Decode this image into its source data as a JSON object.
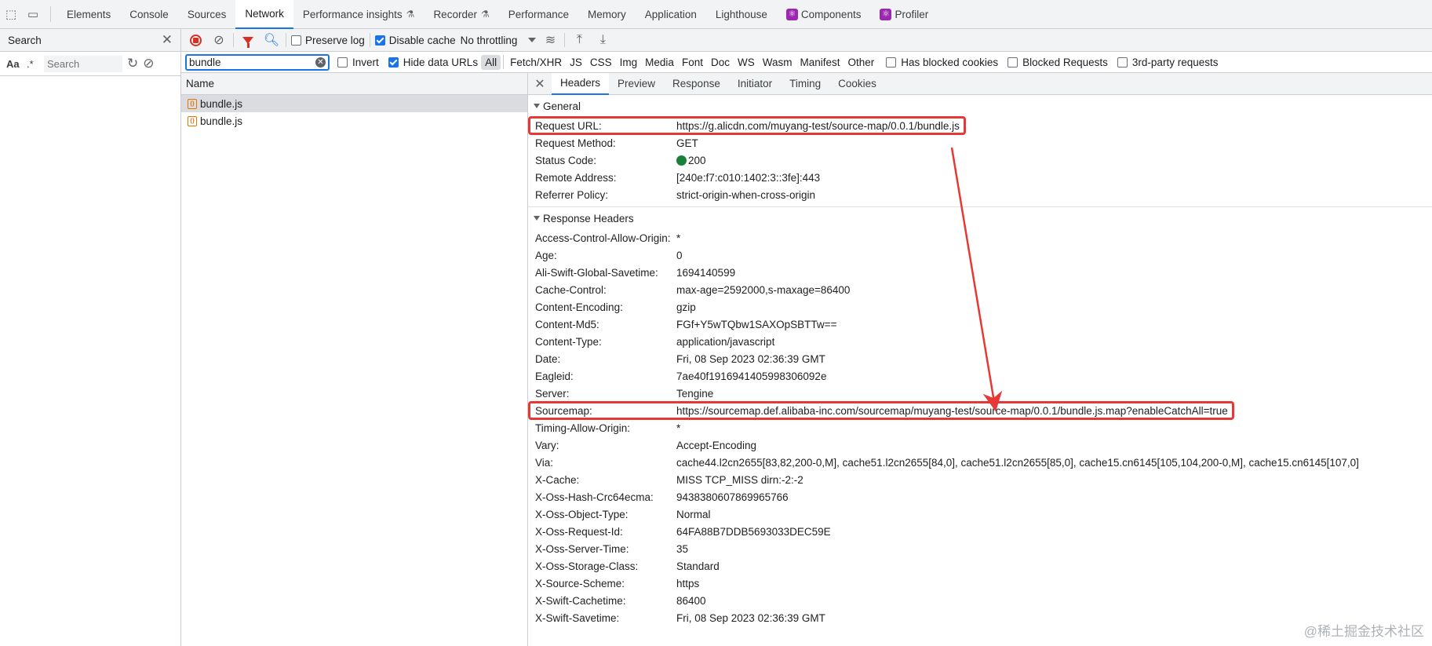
{
  "tabs": [
    {
      "label": "Elements",
      "active": false,
      "badge": ""
    },
    {
      "label": "Console",
      "active": false,
      "badge": ""
    },
    {
      "label": "Sources",
      "active": false,
      "badge": ""
    },
    {
      "label": "Network",
      "active": true,
      "badge": ""
    },
    {
      "label": "Performance insights",
      "active": false,
      "badge": "flask"
    },
    {
      "label": "Recorder",
      "active": false,
      "badge": "flask"
    },
    {
      "label": "Performance",
      "active": false,
      "badge": ""
    },
    {
      "label": "Memory",
      "active": false,
      "badge": ""
    },
    {
      "label": "Application",
      "active": false,
      "badge": ""
    },
    {
      "label": "Lighthouse",
      "active": false,
      "badge": ""
    },
    {
      "label": "Components",
      "active": false,
      "badge": "react"
    },
    {
      "label": "Profiler",
      "active": false,
      "badge": "react"
    }
  ],
  "search_panel": {
    "title": "Search",
    "aa_label": "Aa",
    "regex_label": ".*",
    "placeholder": "Search"
  },
  "toolbar": {
    "preserve_log": {
      "label": "Preserve log",
      "checked": false
    },
    "disable_cache": {
      "label": "Disable cache",
      "checked": true
    },
    "throttling": "No throttling"
  },
  "filter_bar": {
    "value": "bundle",
    "invert": {
      "label": "Invert",
      "checked": false
    },
    "hide_data_urls": {
      "label": "Hide data URLs",
      "checked": true
    },
    "types": [
      "All",
      "Fetch/XHR",
      "JS",
      "CSS",
      "Img",
      "Media",
      "Font",
      "Doc",
      "WS",
      "Wasm",
      "Manifest",
      "Other"
    ],
    "active_type": "All",
    "has_blocked_cookies": {
      "label": "Has blocked cookies",
      "checked": false
    },
    "blocked_requests": {
      "label": "Blocked Requests",
      "checked": false
    },
    "third_party": {
      "label": "3rd-party requests",
      "checked": false
    }
  },
  "request_list": {
    "header": "Name",
    "rows": [
      {
        "name": "bundle.js",
        "selected": true
      },
      {
        "name": "bundle.js",
        "selected": false
      }
    ]
  },
  "detail_tabs": [
    "Headers",
    "Preview",
    "Response",
    "Initiator",
    "Timing",
    "Cookies"
  ],
  "general": {
    "title": "General",
    "rows": [
      {
        "key": "Request URL:",
        "value": "https://g.alicdn.com/muyang-test/source-map/0.0.1/bundle.js",
        "highlight": true
      },
      {
        "key": "Request Method:",
        "value": "GET"
      },
      {
        "key": "Status Code:",
        "value": "200",
        "status_dot": true
      },
      {
        "key": "Remote Address:",
        "value": "[240e:f7:c010:1402:3::3fe]:443"
      },
      {
        "key": "Referrer Policy:",
        "value": "strict-origin-when-cross-origin"
      }
    ]
  },
  "response_headers": {
    "title": "Response Headers",
    "rows": [
      {
        "key": "Access-Control-Allow-Origin:",
        "value": "*"
      },
      {
        "key": "Age:",
        "value": "0"
      },
      {
        "key": "Ali-Swift-Global-Savetime:",
        "value": "1694140599"
      },
      {
        "key": "Cache-Control:",
        "value": "max-age=2592000,s-maxage=86400"
      },
      {
        "key": "Content-Encoding:",
        "value": "gzip"
      },
      {
        "key": "Content-Md5:",
        "value": "FGf+Y5wTQbw1SAXOpSBTTw=="
      },
      {
        "key": "Content-Type:",
        "value": "application/javascript"
      },
      {
        "key": "Date:",
        "value": "Fri, 08 Sep 2023 02:36:39 GMT"
      },
      {
        "key": "Eagleid:",
        "value": "7ae40f1916941405998306092e"
      },
      {
        "key": "Server:",
        "value": "Tengine"
      },
      {
        "key": "Sourcemap:",
        "value": "https://sourcemap.def.alibaba-inc.com/sourcemap/muyang-test/source-map/0.0.1/bundle.js.map?enableCatchAll=true",
        "highlight": true
      },
      {
        "key": "Timing-Allow-Origin:",
        "value": "*"
      },
      {
        "key": "Vary:",
        "value": "Accept-Encoding"
      },
      {
        "key": "Via:",
        "value": "cache44.l2cn2655[83,82,200-0,M], cache51.l2cn2655[84,0], cache51.l2cn2655[85,0], cache15.cn6145[105,104,200-0,M], cache15.cn6145[107,0]"
      },
      {
        "key": "X-Cache:",
        "value": "MISS TCP_MISS dirn:-2:-2"
      },
      {
        "key": "X-Oss-Hash-Crc64ecma:",
        "value": "9438380607869965766"
      },
      {
        "key": "X-Oss-Object-Type:",
        "value": "Normal"
      },
      {
        "key": "X-Oss-Request-Id:",
        "value": "64FA88B7DDB5693033DEC59E"
      },
      {
        "key": "X-Oss-Server-Time:",
        "value": "35"
      },
      {
        "key": "X-Oss-Storage-Class:",
        "value": "Standard"
      },
      {
        "key": "X-Source-Scheme:",
        "value": "https"
      },
      {
        "key": "X-Swift-Cachetime:",
        "value": "86400"
      },
      {
        "key": "X-Swift-Savetime:",
        "value": "Fri, 08 Sep 2023 02:36:39 GMT"
      }
    ]
  },
  "annotation_color": "#e53935",
  "watermark": "@稀土掘金技术社区"
}
